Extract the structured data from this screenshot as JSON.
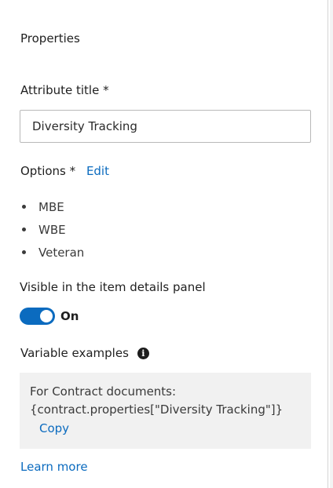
{
  "panel": {
    "heading": "Properties",
    "attribute_title_label": "Attribute title *",
    "attribute_title_value": "Diversity Tracking",
    "options_label": "Options *",
    "options_edit": "Edit",
    "options": [
      "MBE",
      "WBE",
      "Veteran"
    ],
    "visible_label": "Visible in the item details panel",
    "visible_state": "On",
    "variable_examples_label": "Variable examples",
    "example_line1": "For Contract documents:",
    "example_line2": "{contract.properties[\"Diversity Tracking\"]}",
    "copy_label": "Copy",
    "learn_more": "Learn more"
  },
  "colors": {
    "accent": "#0b6bbf",
    "example_bg": "#f1f1f1",
    "text": "#1f1f1f"
  },
  "icons": {
    "info": "info-icon",
    "toggle": "toggle-switch"
  }
}
